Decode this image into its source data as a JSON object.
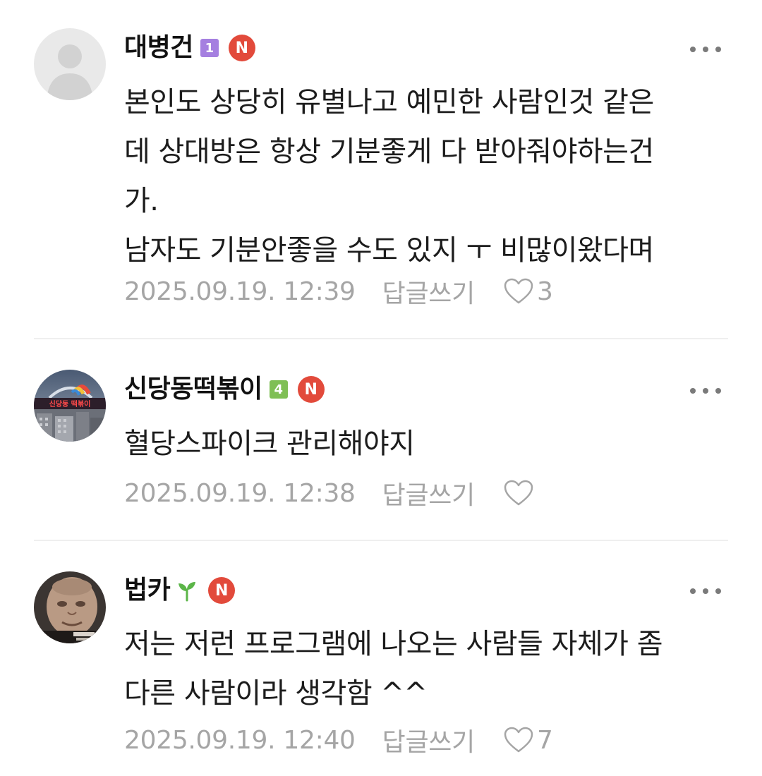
{
  "comments": [
    {
      "author": "대병건",
      "level": "1",
      "level_color": "#a57fe0",
      "badge": "N",
      "lines": [
        "본인도 상당히 유별나고 예민한 사람인것 같은",
        "데 상대방은 항상 기분좋게 다 받아줘야하는건",
        "가.",
        "남자도 기분안좋을 수도 있지 ㅜ 비많이왔다며"
      ],
      "date": "2025.09.19. 12:39",
      "reply_label": "답글쓰기",
      "likes": "3",
      "avatar": "default-avatar"
    },
    {
      "author": "신당동떡볶이",
      "level": "4",
      "level_color": "#7fbf55",
      "badge": "N",
      "lines": [
        "혈당스파이크 관리해야지"
      ],
      "date": "2025.09.19. 12:38",
      "reply_label": "답글쓰기",
      "likes": "",
      "avatar": "photo-avatar-sign",
      "avatar_sign_text": "신당동 떡볶이"
    },
    {
      "author": "법카",
      "level": "",
      "level_icon": "sprout-icon",
      "level_color": "#5bb548",
      "badge": "N",
      "lines": [
        "저는 저런 프로그램에 나오는 사람들 자체가 좀",
        "다른 사람이라 생각함 ^^"
      ],
      "date": "2025.09.19. 12:40",
      "reply_label": "답글쓰기",
      "likes": "7",
      "avatar": "photo-avatar-person"
    }
  ],
  "colors": {
    "badge_n": "#e24a3b",
    "meta_text": "#a5a5a5",
    "divider": "#efefef"
  },
  "icons": {
    "more": "more-dots-icon",
    "like": "heart-outline-icon"
  }
}
